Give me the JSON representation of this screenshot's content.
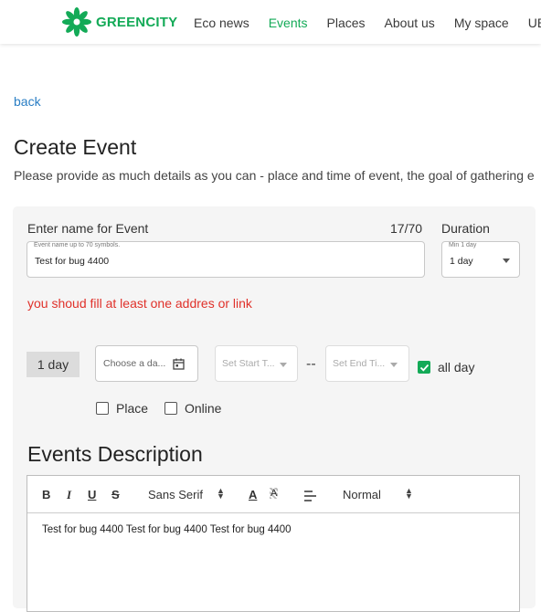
{
  "header": {
    "logo_text": "GREENCITY",
    "nav": [
      "Eco news",
      "Events",
      "Places",
      "About us",
      "My space",
      "UBS c"
    ],
    "active_nav": "Events"
  },
  "back_link": "back",
  "page_title": "Create Event",
  "page_subtitle": "Please provide as much details as you can - place and time of event, the goal of gathering e",
  "form": {
    "name_label": "Enter name for Event",
    "name_counter": "17/70",
    "name_hint": "Event name up to 70 symbols.",
    "name_value": "Test for bug 4400",
    "duration_label": "Duration",
    "duration_hint": "Min 1 day",
    "duration_value": "1 day",
    "error_text": "you shoud fill at least one addres or link",
    "day_chip": "1 day",
    "date_placeholder": "Choose a da...",
    "start_placeholder": "Set Start T...",
    "separator": "--",
    "end_placeholder": "Set End Ti...",
    "all_day_label": "all day",
    "all_day_checked": true,
    "place_label": "Place",
    "online_label": "Online"
  },
  "description": {
    "title": "Events Description",
    "font_value": "Sans Serif",
    "size_value": "Normal",
    "content": "Test for bug 4400 Test for bug 4400 Test for bug 4400"
  },
  "colors": {
    "brand": "#13aa57",
    "error": "#e0312a",
    "link": "#2a7ec4"
  }
}
